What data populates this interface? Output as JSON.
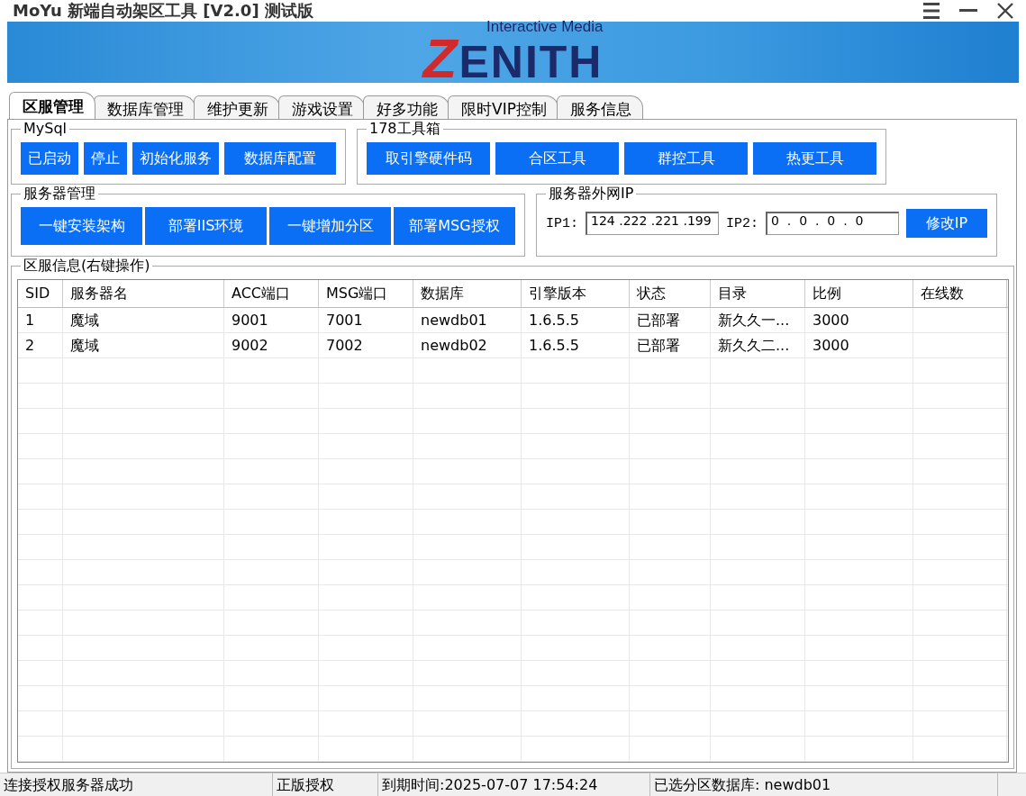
{
  "window": {
    "title": "MoYu 新端自动架区工具 [V2.0] 测试版"
  },
  "banner": {
    "logo_tagline": "Interactive Media",
    "logo_text": "ZENITH"
  },
  "tabs": [
    {
      "label": "区服管理",
      "selected": true
    },
    {
      "label": "数据库管理",
      "selected": false
    },
    {
      "label": "维护更新",
      "selected": false
    },
    {
      "label": "游戏设置",
      "selected": false
    },
    {
      "label": "好多功能",
      "selected": false
    },
    {
      "label": "限时VIP控制",
      "selected": false
    },
    {
      "label": "服务信息",
      "selected": false
    }
  ],
  "mysql": {
    "title": "MySql",
    "buttons": [
      "已启动",
      "停止",
      "初始化服务",
      "数据库配置"
    ]
  },
  "toolbox": {
    "title": "178工具箱",
    "buttons": [
      "取引擎硬件码",
      "合区工具",
      "群控工具",
      "热更工具"
    ]
  },
  "server_management": {
    "title": "服务器管理",
    "buttons": [
      "一键安装架构",
      "部署IIS环境",
      "一键增加分区",
      "部署MSG授权"
    ]
  },
  "external_ip": {
    "title": "服务器外网IP",
    "fields": [
      {
        "label": "IP1:",
        "value": "124 .222 .221 .199"
      },
      {
        "label": "IP2:",
        "value": "0  .  0  .  0  .  0"
      }
    ],
    "button": "修改IP"
  },
  "server_list": {
    "title": "区服信息(右键操作)",
    "columns": [
      "SID",
      "服务器名",
      "ACC端口",
      "MSG端口",
      "数据库",
      "引擎版本",
      "状态",
      "目录",
      "比例",
      "在线数"
    ],
    "rows": [
      {
        "sid": "1",
        "server_name": "魔域",
        "acc_port": "9001",
        "msg_port": "7001",
        "database": "newdb01",
        "engine_version": "1.6.5.5",
        "status": "已部署",
        "directory": "新久久一...",
        "ratio": "3000"
      },
      {
        "sid": "2",
        "server_name": "魔域",
        "acc_port": "9002",
        "msg_port": "7002",
        "database": "newdb02",
        "engine_version": "1.6.5.5",
        "status": "已部署",
        "directory": "新久久二...",
        "ratio": "3000"
      }
    ]
  },
  "status_bar": [
    "连接授权服务器成功",
    "正版授权",
    "到期时间:2025-07-07 17:54:24",
    "已选分区数据库: newdb01"
  ]
}
